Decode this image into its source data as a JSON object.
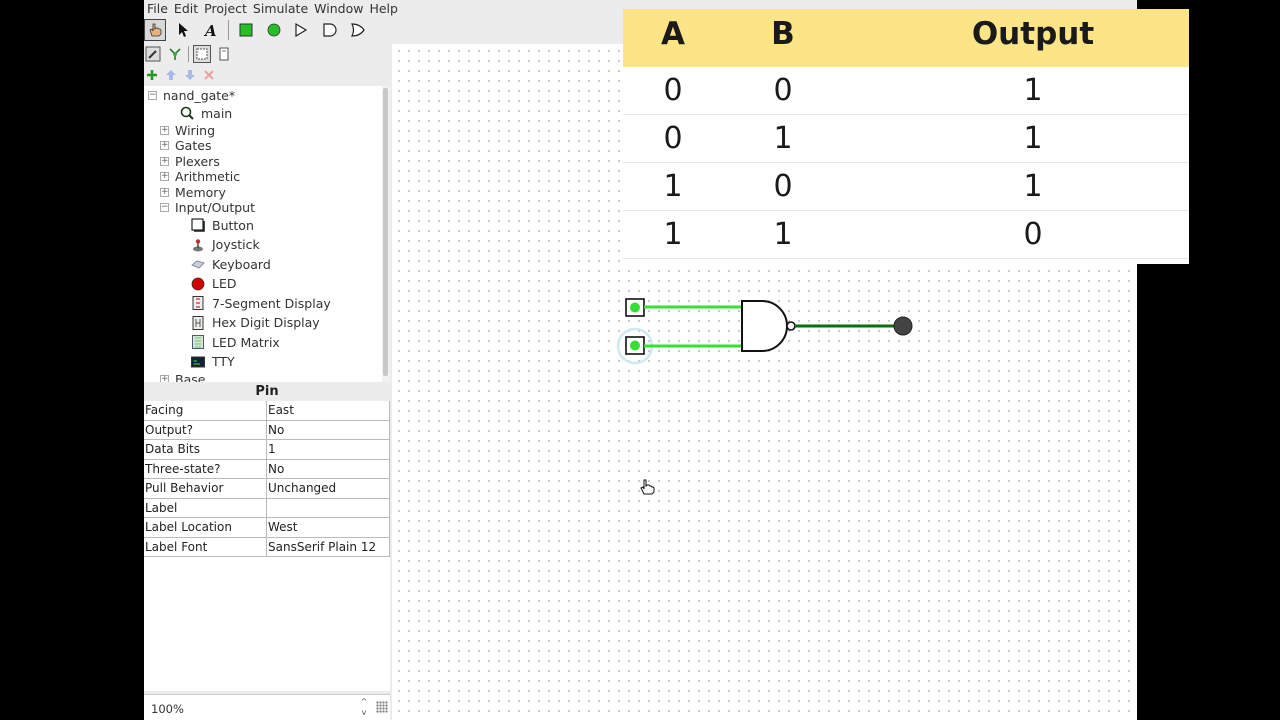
{
  "menu": [
    "File",
    "Edit",
    "Project",
    "Simulate",
    "Window",
    "Help"
  ],
  "toolbar": {
    "tools": [
      "poke-tool",
      "select-tool",
      "text-tool",
      "input-pin",
      "output-pin",
      "not-gate",
      "and-gate",
      "or-gate"
    ]
  },
  "tree": {
    "project": "nand_gate*",
    "main": "main",
    "folders": [
      "Wiring",
      "Gates",
      "Plexers",
      "Arithmetic",
      "Memory",
      "Input/Output"
    ],
    "io_items": [
      "Button",
      "Joystick",
      "Keyboard",
      "LED",
      "7-Segment Display",
      "Hex Digit Display",
      "LED Matrix",
      "TTY"
    ],
    "base": "Base"
  },
  "properties": {
    "title": "Pin",
    "rows": [
      {
        "key": "Facing",
        "value": "East"
      },
      {
        "key": "Output?",
        "value": "No"
      },
      {
        "key": "Data Bits",
        "value": "1"
      },
      {
        "key": "Three-state?",
        "value": "No"
      },
      {
        "key": "Pull Behavior",
        "value": "Unchanged"
      },
      {
        "key": "Label",
        "value": ""
      },
      {
        "key": "Label Location",
        "value": "West"
      },
      {
        "key": "Label Font",
        "value": "SansSerif Plain 12"
      }
    ]
  },
  "zoom": {
    "value": "100%",
    "up": "^",
    "down": "v"
  },
  "truth_table": {
    "headers": [
      "A",
      "B",
      "Output"
    ],
    "rows": [
      [
        "0",
        "0",
        "1"
      ],
      [
        "0",
        "1",
        "1"
      ],
      [
        "1",
        "0",
        "1"
      ],
      [
        "1",
        "1",
        "0"
      ]
    ]
  },
  "colors": {
    "wire_on": "#33e033",
    "wire_off": "#0a6e0a",
    "header_bg": "#fce487",
    "led_red": "#d40000"
  }
}
